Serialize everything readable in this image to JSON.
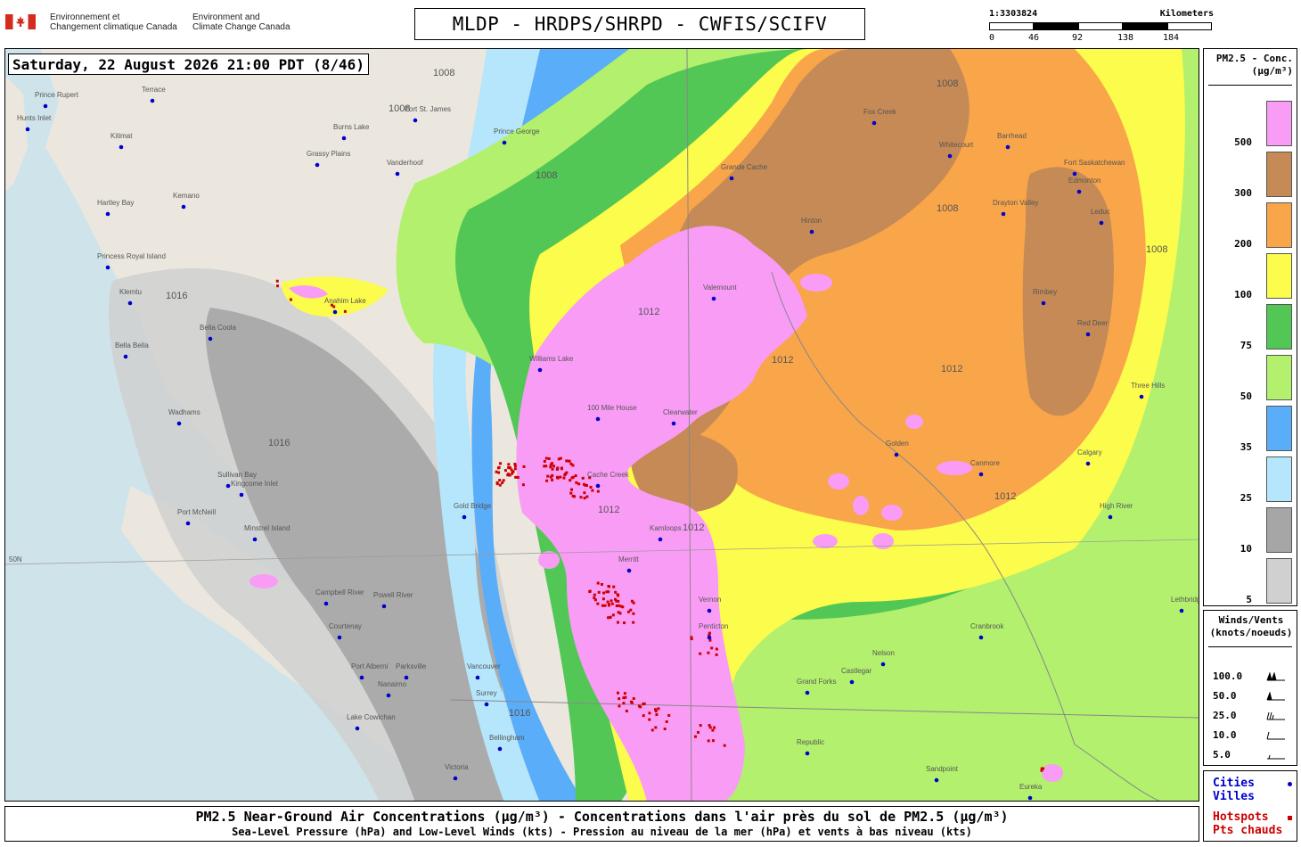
{
  "header": {
    "agency_fr": [
      "Environnement et",
      "Changement climatique Canada"
    ],
    "agency_en": [
      "Environment and",
      "Climate Change Canada"
    ],
    "title": "MLDP - HRDPS/SHRPD - CWFIS/SCIFV",
    "scale": {
      "ratio": "1:3303824",
      "unit": "Kilometers",
      "ticks": [
        "0",
        "46",
        "92",
        "138",
        "184"
      ]
    }
  },
  "map": {
    "timestamp": "Saturday, 22 August 2026 21:00 PDT (8/46)",
    "latitude_label": "50N",
    "isobars": [
      "1008",
      "1008",
      "1008",
      "1008",
      "1008",
      "1008",
      "1012",
      "1012",
      "1012",
      "1012",
      "1012",
      "1012",
      "1016",
      "1016",
      "1016"
    ],
    "places": [
      "Prince Rupert",
      "Terrace",
      "Hunts Inlet",
      "Kitimat",
      "Hartley Bay",
      "Kemano",
      "Princess Royal Island",
      "Klemtu",
      "Bella Coola",
      "Bella Bella",
      "Wadhams",
      "Port McNeill",
      "Minstrel Island",
      "Kingcome Inlet",
      "Sullivan Bay",
      "Campbell River",
      "Courtenay",
      "Powell River",
      "Port Alberni",
      "Nanaimo",
      "Parksville",
      "Lake Cowichan",
      "Victoria",
      "Vancouver",
      "Surrey",
      "Bellingham",
      "Fort St. James",
      "Burns Lake",
      "Grassy Plains",
      "Vanderhoof",
      "Prince George",
      "Anahim Lake",
      "Williams Lake",
      "100 Mile House",
      "Clearwater",
      "Kamloops",
      "Merritt",
      "Penticton",
      "Vernon",
      "Cache Creek",
      "Gold Bridge",
      "Valemount",
      "Grande Cache",
      "Hinton",
      "Fox Creek",
      "Whitecourt",
      "Barrhead",
      "Fort Saskatchewan",
      "Edmonton",
      "Leduc",
      "Drayton Valley",
      "Rimbey",
      "Red Deer",
      "Calgary",
      "High River",
      "Golden",
      "Canmore",
      "Nelson",
      "Castlegar",
      "Cranbrook",
      "Grand Forks",
      "Republic",
      "Sandpoint",
      "Eureka",
      "Three Hills",
      "Lethbridge"
    ],
    "colors": {
      "sea": "#cfe3ea",
      "land": "#ebe7df",
      "c5": "#d0d0d0",
      "c10": "#a6a6a6",
      "c25": "#b5e6fb",
      "c35": "#5aadf8",
      "c50": "#b2f06e",
      "c75": "#53c755",
      "c100": "#fcfc4c",
      "c200": "#f9a54a",
      "c300": "#c58a55",
      "c500": "#f99cf5",
      "hotspot": "#cc0000",
      "city": "#0000cc"
    }
  },
  "legend_pm": {
    "title_line1": "PM2.5 - Conc.",
    "title_line2": "(µg/m³)",
    "levels": [
      {
        "label": "500",
        "color": "#f99cf5"
      },
      {
        "label": "300",
        "color": "#c58a55"
      },
      {
        "label": "200",
        "color": "#f9a54a"
      },
      {
        "label": "100",
        "color": "#fcfc4c"
      },
      {
        "label": "75",
        "color": "#53c755"
      },
      {
        "label": "50",
        "color": "#b2f06e"
      },
      {
        "label": "35",
        "color": "#5aadf8"
      },
      {
        "label": "25",
        "color": "#b5e6fb"
      },
      {
        "label": "10",
        "color": "#a6a6a6"
      },
      {
        "label": "5",
        "color": "#d0d0d0"
      }
    ]
  },
  "legend_wind": {
    "title_line1": "Winds/Vents",
    "title_line2": "(knots/noeuds)",
    "rows": [
      "100.0",
      "50.0",
      "25.0",
      "10.0",
      "5.0"
    ]
  },
  "legend_points": {
    "cities_en": "Cities",
    "cities_fr": "Villes",
    "hotspots_en": "Hotspots",
    "hotspots_fr": "Pts chauds"
  },
  "footer": {
    "line1": "PM2.5 Near-Ground Air Concentrations (µg/m³) - Concentrations dans l'air près du sol de PM2.5 (µg/m³)",
    "line2": "Sea-Level Pressure (hPa) and Low-Level Winds (kts) - Pression au niveau de la mer (hPa) et vents à bas niveau (kts)"
  }
}
